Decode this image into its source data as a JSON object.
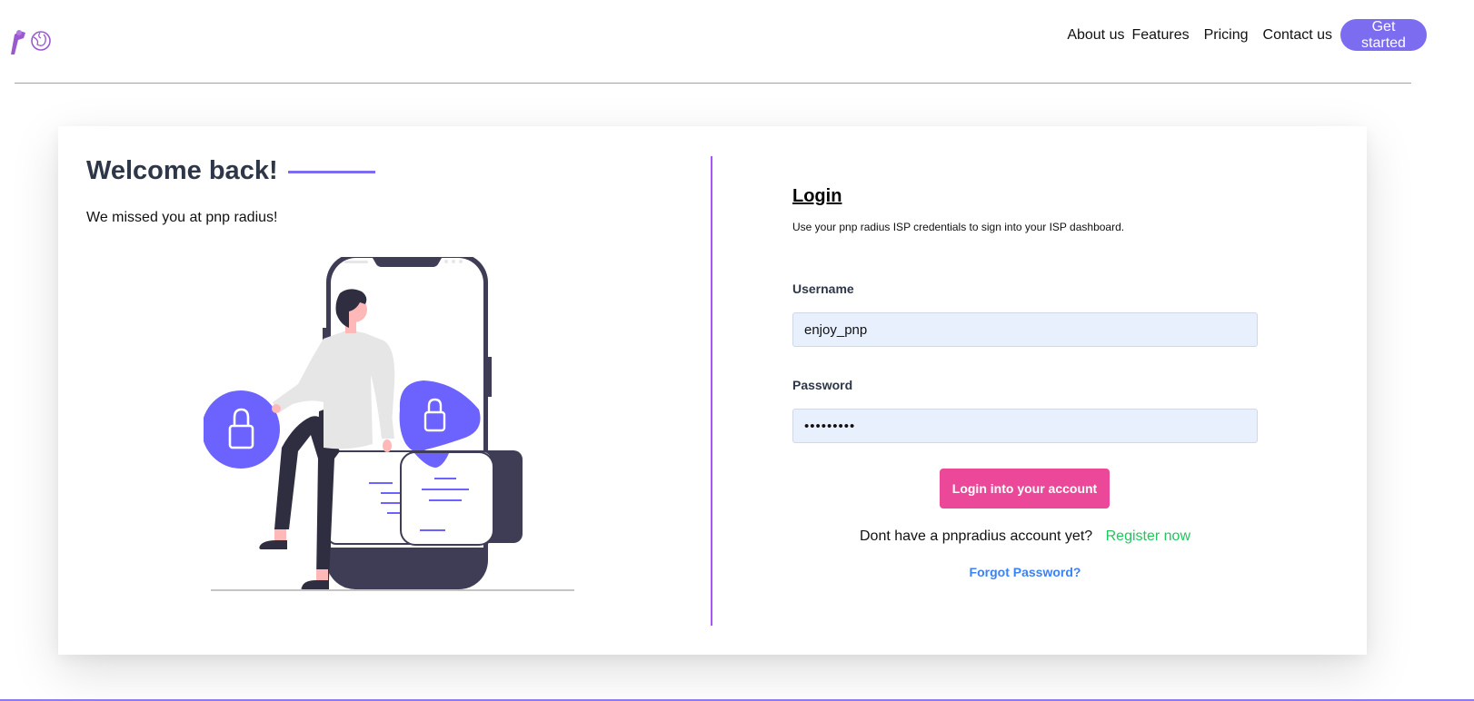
{
  "header": {
    "logo_icon": "pnp-radius-logo-icon",
    "nav": {
      "about": "About us",
      "features": "Features",
      "pricing": "Pricing",
      "contact": "Contact us",
      "get_started": "Get started"
    }
  },
  "welcome": {
    "title": "Welcome back!",
    "subtitle": "We missed you at pnp radius!",
    "illustration_icon": "secure-login-illustration-icon"
  },
  "login": {
    "heading": "Login",
    "description": "Use your pnp radius ISP credentials to sign into your ISP dashboard.",
    "username_label": "Username",
    "username_value": "enjoy_pnp",
    "password_label": "Password",
    "password_value": "•••••••••",
    "submit_label": "Login into your account",
    "register_prompt": "Dont have a pnpradius account yet?",
    "register_link": "Register now",
    "forgot_password": "Forgot Password?"
  },
  "colors": {
    "accent_purple": "#7c6cf0",
    "divider_purple": "#a855f7",
    "login_button": "#ec4899",
    "register_link": "#22c55e",
    "forgot_link": "#3b82f6",
    "input_background": "#e8f0fe"
  }
}
